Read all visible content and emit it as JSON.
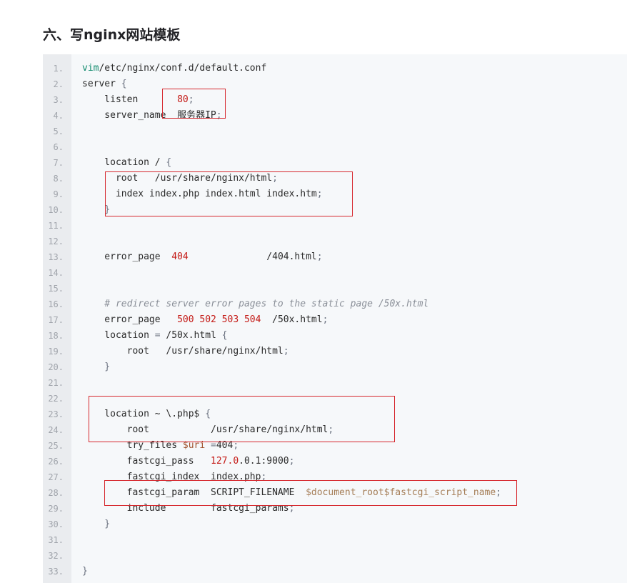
{
  "heading": "六、写nginx网站模板",
  "code_lines": [
    {
      "n": "1.",
      "segs": [
        [
          "kw",
          "vim"
        ],
        [
          "",
          "/etc/nginx/conf.d/default.conf"
        ]
      ]
    },
    {
      "n": "2.",
      "segs": [
        [
          "",
          "server "
        ],
        [
          "punc",
          "{"
        ]
      ]
    },
    {
      "n": "3.",
      "segs": [
        [
          "",
          "    listen       "
        ],
        [
          "num",
          "80"
        ],
        [
          "punc",
          ";"
        ]
      ]
    },
    {
      "n": "4.",
      "segs": [
        [
          "",
          "    server_name  "
        ],
        [
          "cjk",
          "服务器"
        ],
        [
          "",
          "IP"
        ],
        [
          "punc",
          ";"
        ]
      ]
    },
    {
      "n": "5.",
      "segs": []
    },
    {
      "n": "6.",
      "segs": []
    },
    {
      "n": "7.",
      "segs": [
        [
          "",
          "    location / "
        ],
        [
          "punc",
          "{"
        ]
      ]
    },
    {
      "n": "8.",
      "segs": [
        [
          "",
          "      root   /usr/share/nginx/html"
        ],
        [
          "punc",
          ";"
        ]
      ]
    },
    {
      "n": "9.",
      "segs": [
        [
          "",
          "      index index.php index.html index.htm"
        ],
        [
          "punc",
          ";"
        ]
      ]
    },
    {
      "n": "10.",
      "segs": [
        [
          "punc",
          "    }"
        ]
      ]
    },
    {
      "n": "11.",
      "segs": []
    },
    {
      "n": "12.",
      "segs": []
    },
    {
      "n": "13.",
      "segs": [
        [
          "",
          "    error_page  "
        ],
        [
          "num",
          "404"
        ],
        [
          "",
          "              /404.html"
        ],
        [
          "punc",
          ";"
        ]
      ]
    },
    {
      "n": "14.",
      "segs": []
    },
    {
      "n": "15.",
      "segs": []
    },
    {
      "n": "16.",
      "segs": [
        [
          "cmt",
          "    # redirect server error pages to the static page /50x.html"
        ]
      ]
    },
    {
      "n": "17.",
      "segs": [
        [
          "",
          "    error_page   "
        ],
        [
          "num",
          "500 502 503 504"
        ],
        [
          "",
          "  /50x.html"
        ],
        [
          "punc",
          ";"
        ]
      ]
    },
    {
      "n": "18.",
      "segs": [
        [
          "",
          "    location "
        ],
        [
          "punc",
          "="
        ],
        [
          "",
          " /50x.html "
        ],
        [
          "punc",
          "{"
        ]
      ]
    },
    {
      "n": "19.",
      "segs": [
        [
          "",
          "        root   /usr/share/nginx/html"
        ],
        [
          "punc",
          ";"
        ]
      ]
    },
    {
      "n": "20.",
      "segs": [
        [
          "punc",
          "    }"
        ]
      ]
    },
    {
      "n": "21.",
      "segs": []
    },
    {
      "n": "22.",
      "segs": []
    },
    {
      "n": "23.",
      "segs": [
        [
          "",
          "    location ~ \\.php$ "
        ],
        [
          "punc",
          "{"
        ]
      ]
    },
    {
      "n": "24.",
      "segs": [
        [
          "",
          "        root           /usr/share/nginx/html"
        ],
        [
          "punc",
          ";"
        ]
      ]
    },
    {
      "n": "25.",
      "segs": [
        [
          "",
          "        try_files "
        ],
        [
          "var",
          "$uri"
        ],
        [
          "",
          " "
        ],
        [
          "punc",
          "="
        ],
        [
          "",
          "404"
        ],
        [
          "punc",
          ";"
        ]
      ]
    },
    {
      "n": "26.",
      "segs": [
        [
          "",
          "        fastcgi_pass   "
        ],
        [
          "num",
          "127.0"
        ],
        [
          "",
          ".0.1:9000"
        ],
        [
          "punc",
          ";"
        ]
      ]
    },
    {
      "n": "27.",
      "segs": [
        [
          "",
          "        fastcgi_index  index.php"
        ],
        [
          "punc",
          ";"
        ]
      ]
    },
    {
      "n": "28.",
      "segs": [
        [
          "",
          "        fastcgi_param  SCRIPT_FILENAME  "
        ],
        [
          "str",
          "$document_root$fastcgi_script_name"
        ],
        [
          "punc",
          ";"
        ]
      ]
    },
    {
      "n": "29.",
      "segs": [
        [
          "",
          "        include        fastcgi_params"
        ],
        [
          "punc",
          ";"
        ]
      ]
    },
    {
      "n": "30.",
      "segs": [
        [
          "punc",
          "    }"
        ]
      ]
    },
    {
      "n": "31.",
      "segs": []
    },
    {
      "n": "32.",
      "segs": []
    },
    {
      "n": "33.",
      "segs": [
        [
          "punc",
          "}"
        ]
      ]
    }
  ],
  "colors": {
    "highlight_border": "#d6272d",
    "code_background": "#f6f8fa",
    "keyword": "#0f8a6c",
    "number": "#c41a16"
  }
}
